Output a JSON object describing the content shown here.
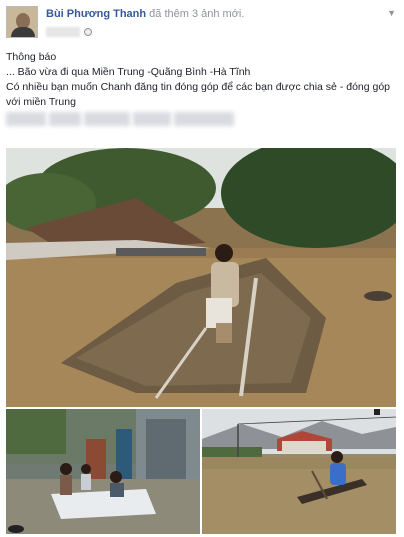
{
  "post": {
    "author": "Bùi Phương Thanh",
    "action": "đã thêm 3 ảnh mới.",
    "lines": [
      "Thông báo",
      "... Bão vừa đi qua Miền Trung -Quãng Bình -Hà Tĩnh",
      "Có nhiều bạn muốn Chanh đăng tin đóng góp để các bạn được chia sẻ - đóng góp với miền Trung"
    ],
    "privacy_icon": "globe-icon",
    "menu_icon": "chevron-down-icon"
  },
  "photos": [
    {
      "description_name": "flood-hut-woman-photo"
    },
    {
      "description_name": "flood-children-raft-photo"
    },
    {
      "description_name": "flood-boat-village-photo"
    }
  ]
}
